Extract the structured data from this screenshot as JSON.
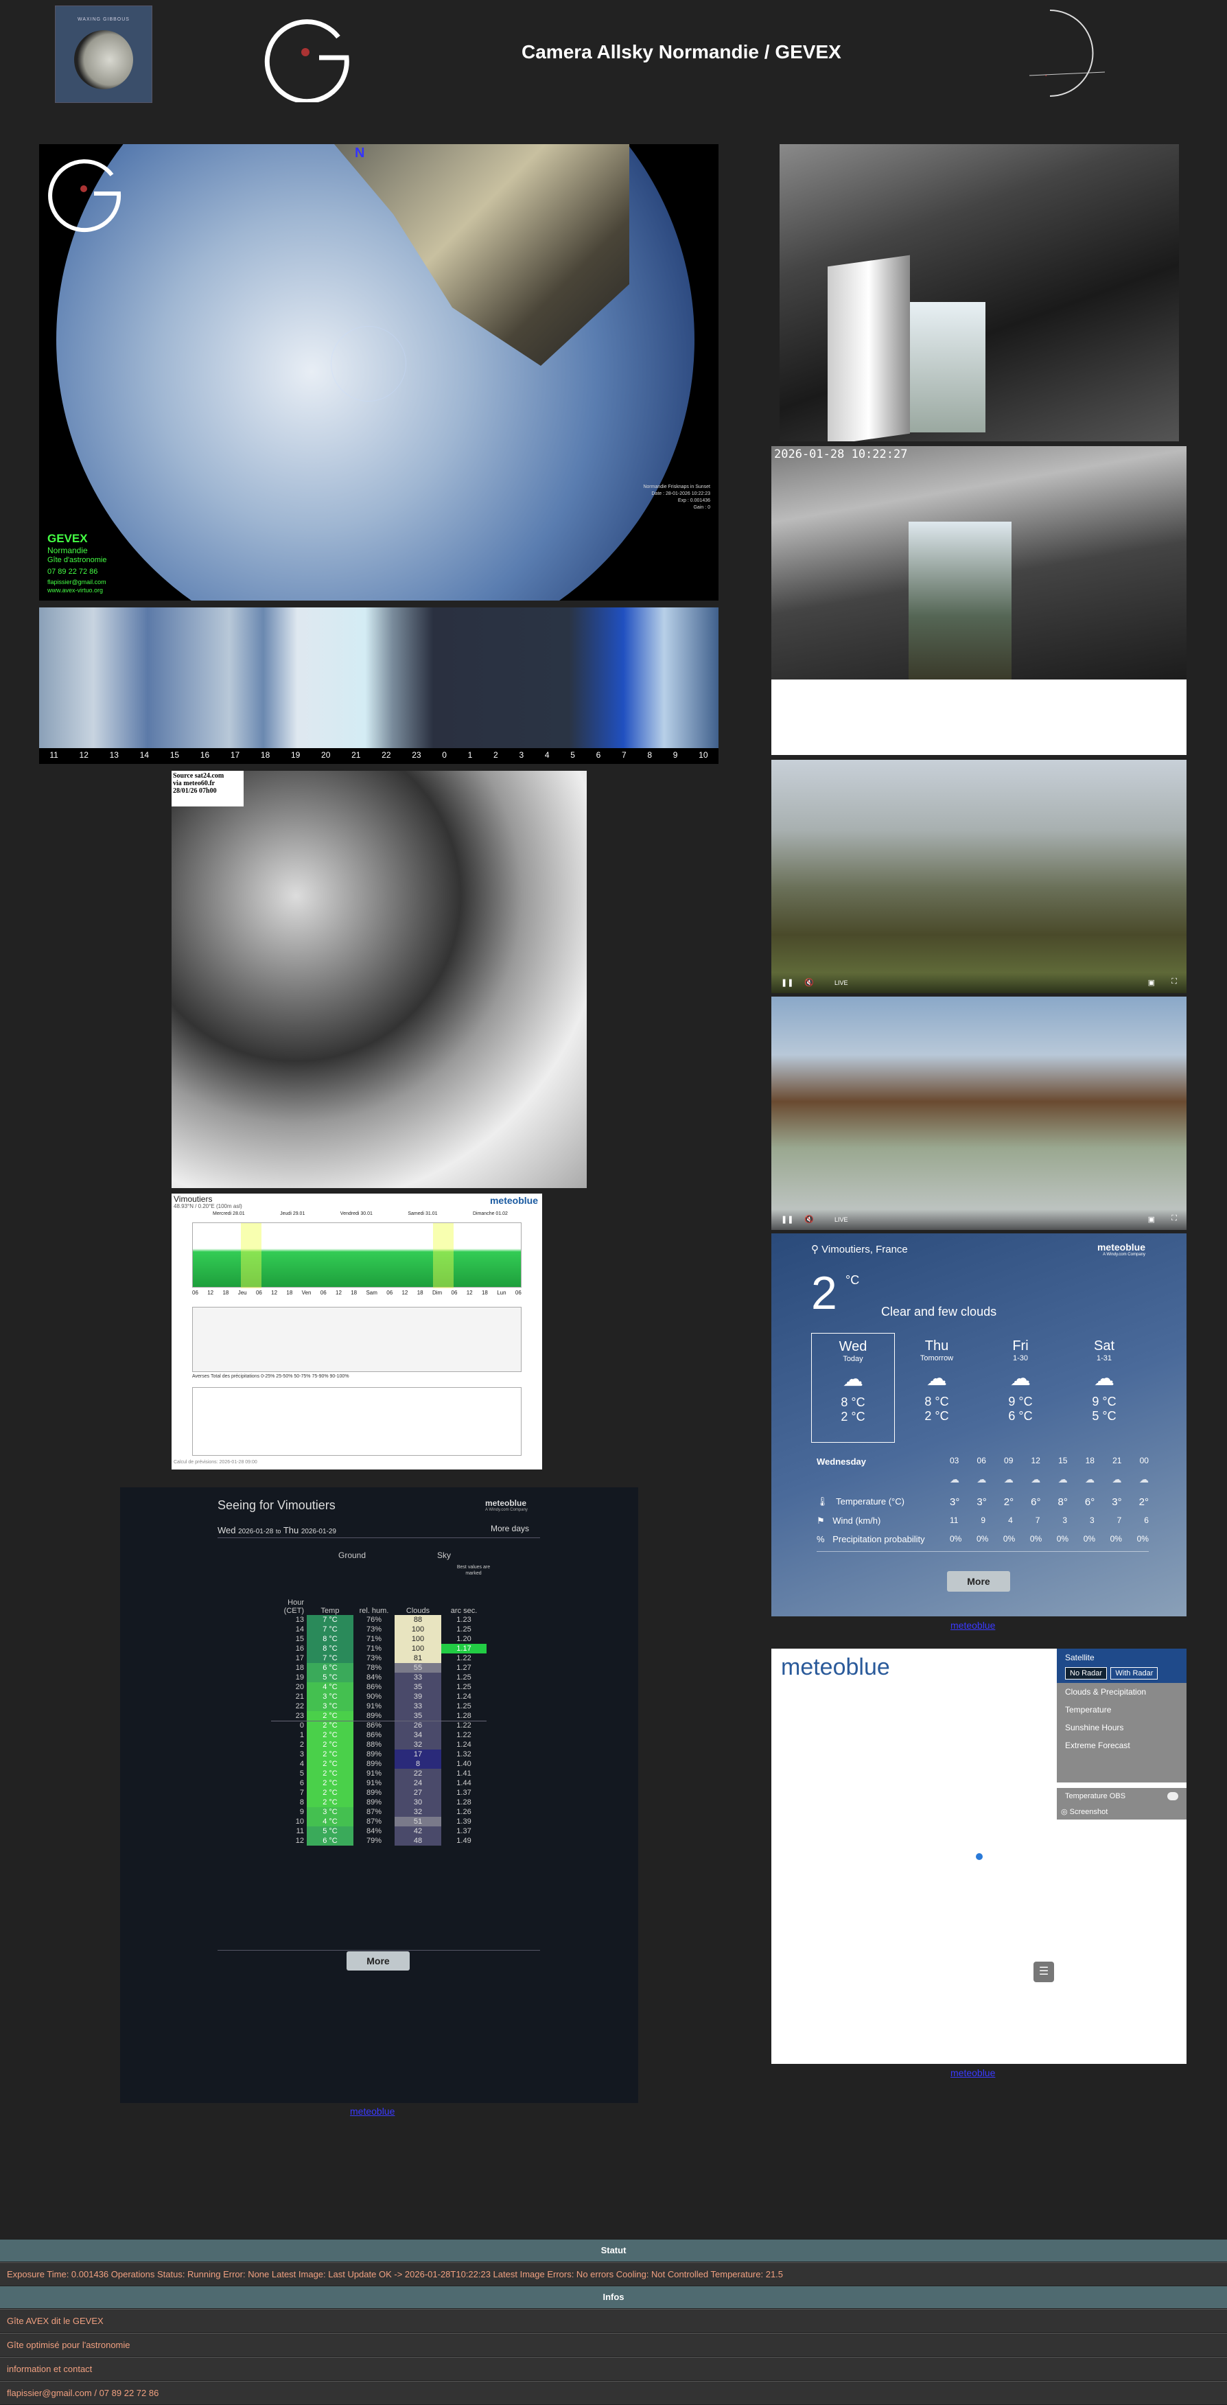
{
  "header": {
    "title": "Camera Allsky Normandie / GEVEX",
    "moon_caption": "WAXING GIBBOUS"
  },
  "allsky": {
    "logo_text": "GEVEX",
    "logo_region": "Normandie",
    "logo_sub": "Gîte d'astronomie",
    "phone": "07 89 22 72 86",
    "email": "flapissier@gmail.com",
    "site": "www.avex-virtuo.org",
    "info_title": "Normandie Frisknaps in Sunset",
    "info_lines": [
      "Date : 28-01-2026 10:22:23",
      "Exp : 0.001436",
      "Gain : 0"
    ],
    "compass_n": "N"
  },
  "keogram": {
    "hours": [
      "11",
      "12",
      "13",
      "14",
      "15",
      "16",
      "17",
      "18",
      "19",
      "20",
      "21",
      "22",
      "23",
      "0",
      "1",
      "2",
      "3",
      "4",
      "5",
      "6",
      "7",
      "8",
      "9",
      "10"
    ]
  },
  "camera2": {
    "timestamp": "2026-01-28 10:22:27"
  },
  "satellite": {
    "source": "Source sat24.com",
    "via": "via meteo60.fr",
    "date": "28/01/26 07h00"
  },
  "live_cams": [
    {
      "live_label": "LIVE"
    },
    {
      "live_label": "LIVE"
    }
  ],
  "forecast_widget": {
    "location": "Vimoutiers, France",
    "brand": "meteoblue",
    "brand_sub": "A Windy.com Company",
    "current_temp": "2",
    "unit": "°C",
    "condition": "Clear and few clouds",
    "days": [
      {
        "day": "Wed",
        "sub": "Today",
        "max": "8 °C",
        "min": "2 °C"
      },
      {
        "day": "Thu",
        "sub": "Tomorrow",
        "max": "8 °C",
        "min": "2 °C"
      },
      {
        "day": "Fri",
        "sub": "1-30",
        "max": "9 °C",
        "min": "6 °C"
      },
      {
        "day": "Sat",
        "sub": "1-31",
        "max": "9 °C",
        "min": "5 °C"
      }
    ],
    "hourly_day": "Wednesday",
    "hours": [
      "03",
      "06",
      "09",
      "12",
      "15",
      "18",
      "21",
      "00"
    ],
    "rows": {
      "temp_label": "Temperature (°C)",
      "temps": [
        "3°",
        "3°",
        "2°",
        "6°",
        "8°",
        "6°",
        "3°",
        "2°"
      ],
      "wind_label": "Wind (km/h)",
      "winds": [
        "11",
        "9",
        "4",
        "7",
        "3",
        "3",
        "7",
        "6"
      ],
      "precip_label": "Precipitation probability",
      "precips": [
        "0%",
        "0%",
        "0%",
        "0%",
        "0%",
        "0%",
        "0%",
        "0%"
      ]
    },
    "more": "More",
    "link": "meteoblue"
  },
  "meteogram": {
    "location": "Vimoutiers",
    "coords": "48.93°N / 0.20°E (100m asl)",
    "brand": "meteoblue",
    "days": [
      "Mercredi 28.01",
      "Jeudi 29.01",
      "Vendredi 30.01",
      "Samedi 31.01",
      "Dimanche 01.02"
    ],
    "hours": [
      "06",
      "12",
      "18",
      "Jeu",
      "06",
      "12",
      "18",
      "Ven",
      "06",
      "12",
      "18",
      "Sam",
      "06",
      "12",
      "18",
      "Dim",
      "06",
      "12",
      "18",
      "Lun",
      "06"
    ],
    "legend": "Averses   Total des précipitations   0-25%   25-50%   50-75%   75-90%   90-100%",
    "footer": "Calcul de prévisions: 2026-01-28 09:00"
  },
  "seeing": {
    "title": "Seeing for Vimoutiers",
    "brand": "meteoblue",
    "brand_sub": "A Windy.com Company",
    "range_from_label": "Wed",
    "range_from": "2026-01-28",
    "range_to_word": "to",
    "range_to_label": "Thu",
    "range_to": "2026-01-29",
    "more_days": "More days",
    "group_ground": "Ground",
    "group_sky": "Sky",
    "col_hour": "Hour (CET)",
    "col_temp": "Temp",
    "col_hum": "rel. hum.",
    "col_clouds": "Clouds",
    "col_arc": "arc sec.",
    "best_note": "Best values are marked",
    "more": "More",
    "link": "meteoblue",
    "rows": [
      {
        "h": "13",
        "t": "7 °C",
        "hu": "76%",
        "c": "88",
        "a": "1.23"
      },
      {
        "h": "14",
        "t": "7 °C",
        "hu": "73%",
        "c": "100",
        "a": "1.25"
      },
      {
        "h": "15",
        "t": "8 °C",
        "hu": "71%",
        "c": "100",
        "a": "1.20"
      },
      {
        "h": "16",
        "t": "8 °C",
        "hu": "71%",
        "c": "100",
        "a": "1.17"
      },
      {
        "h": "17",
        "t": "7 °C",
        "hu": "73%",
        "c": "81",
        "a": "1.22"
      },
      {
        "h": "18",
        "t": "6 °C",
        "hu": "78%",
        "c": "55",
        "a": "1.27"
      },
      {
        "h": "19",
        "t": "5 °C",
        "hu": "84%",
        "c": "33",
        "a": "1.25"
      },
      {
        "h": "20",
        "t": "4 °C",
        "hu": "86%",
        "c": "35",
        "a": "1.25"
      },
      {
        "h": "21",
        "t": "3 °C",
        "hu": "90%",
        "c": "39",
        "a": "1.24"
      },
      {
        "h": "22",
        "t": "3 °C",
        "hu": "91%",
        "c": "33",
        "a": "1.25"
      },
      {
        "h": "23",
        "t": "2 °C",
        "hu": "89%",
        "c": "35",
        "a": "1.28"
      },
      {
        "h": "0",
        "t": "2 °C",
        "hu": "86%",
        "c": "26",
        "a": "1.22"
      },
      {
        "h": "1",
        "t": "2 °C",
        "hu": "86%",
        "c": "34",
        "a": "1.22"
      },
      {
        "h": "2",
        "t": "2 °C",
        "hu": "88%",
        "c": "32",
        "a": "1.24"
      },
      {
        "h": "3",
        "t": "2 °C",
        "hu": "89%",
        "c": "17",
        "a": "1.32"
      },
      {
        "h": "4",
        "t": "2 °C",
        "hu": "89%",
        "c": "8",
        "a": "1.40"
      },
      {
        "h": "5",
        "t": "2 °C",
        "hu": "91%",
        "c": "22",
        "a": "1.41"
      },
      {
        "h": "6",
        "t": "2 °C",
        "hu": "91%",
        "c": "24",
        "a": "1.44"
      },
      {
        "h": "7",
        "t": "2 °C",
        "hu": "89%",
        "c": "27",
        "a": "1.37"
      },
      {
        "h": "8",
        "t": "2 °C",
        "hu": "89%",
        "c": "30",
        "a": "1.28"
      },
      {
        "h": "9",
        "t": "3 °C",
        "hu": "87%",
        "c": "32",
        "a": "1.26"
      },
      {
        "h": "10",
        "t": "4 °C",
        "hu": "87%",
        "c": "51",
        "a": "1.39"
      },
      {
        "h": "11",
        "t": "5 °C",
        "hu": "84%",
        "c": "42",
        "a": "1.37"
      },
      {
        "h": "12",
        "t": "6 °C",
        "hu": "79%",
        "c": "48",
        "a": "1.49"
      }
    ]
  },
  "map_widget": {
    "brand": "meteoblue",
    "menu_title": "Satellite",
    "no_radar": "No Radar",
    "with_radar": "With Radar",
    "items": [
      "Clouds & Precipitation",
      "Temperature",
      "Sunshine Hours",
      "Extreme Forecast"
    ],
    "temp_obs": "Temperature OBS",
    "screenshot": "Screenshot",
    "link": "meteoblue"
  },
  "status": {
    "statut_title": "Statut",
    "statut_text": "Exposure Time: 0.001436 Operations Status: Running Error: None Latest Image: Last Update OK -> 2026-01-28T10:22:23 Latest Image Errors: No errors Cooling: Not Controlled Temperature: 21.5",
    "infos_title": "Infos",
    "infos": [
      "Gîte AVEX dit le GEVEX",
      "Gîte optimisé pour l'astronomie",
      "information et contact",
      "flapissier@gmail.com / 07 89 22 72 86"
    ]
  }
}
